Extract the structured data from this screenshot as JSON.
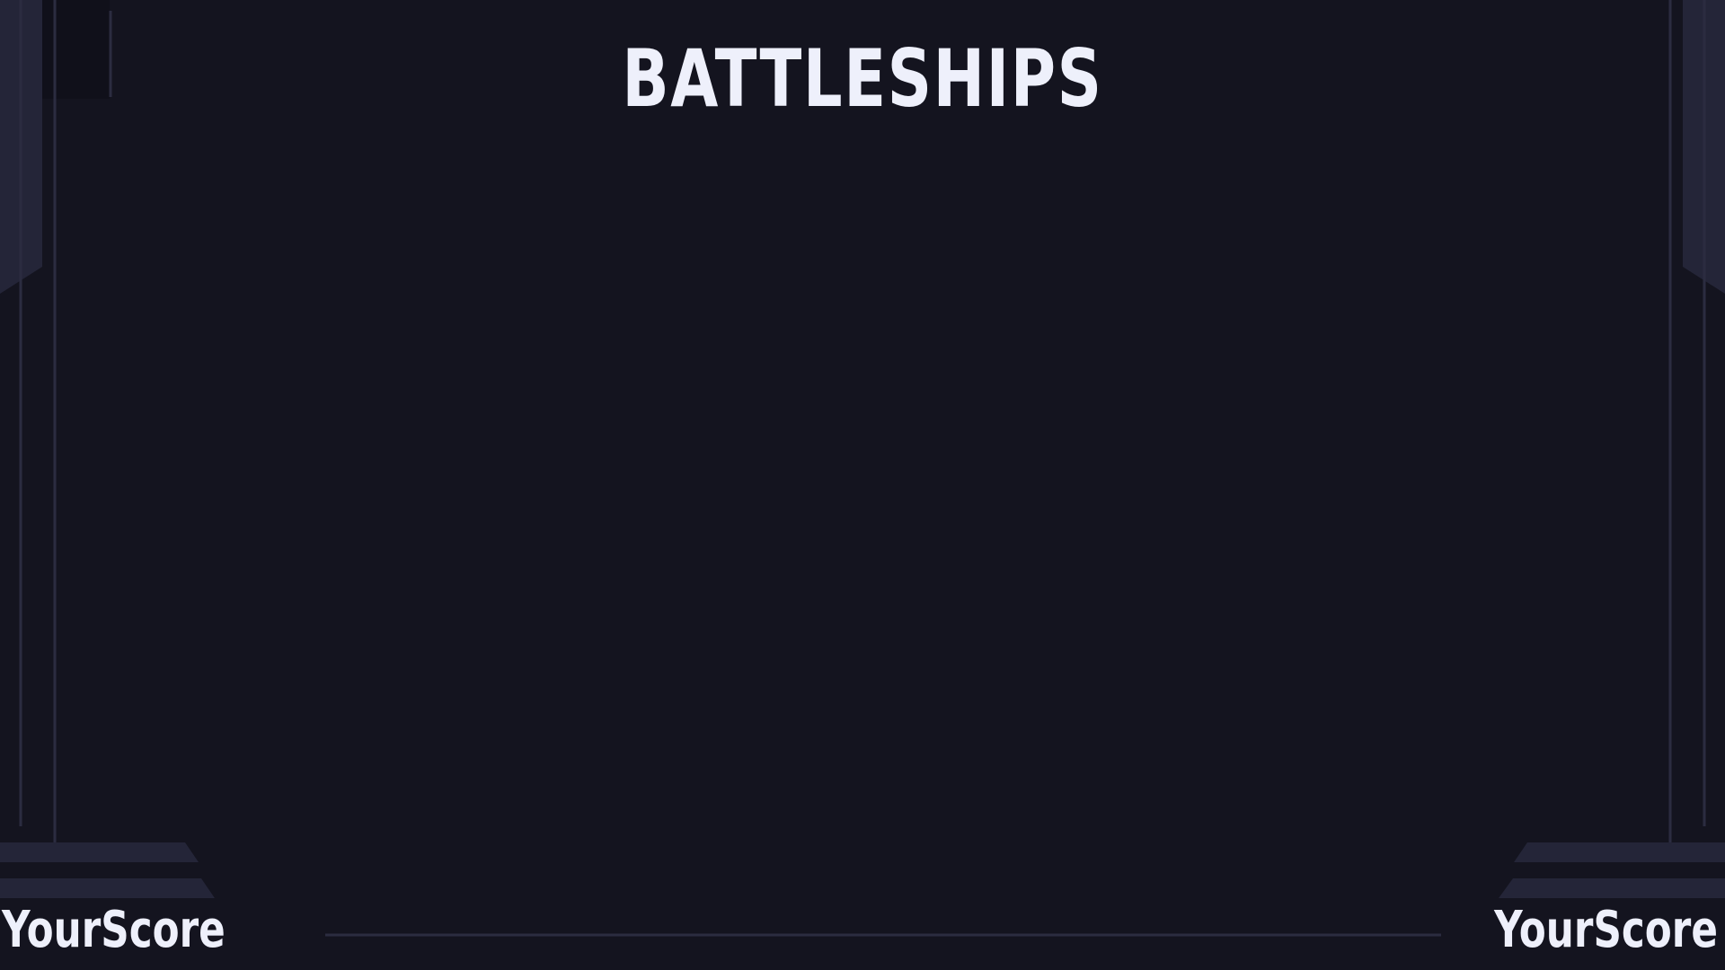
{
  "game": {
    "title": "BATTLESHIPS"
  },
  "scores": {
    "left_label": "YourScore",
    "right_label": "YourScore"
  },
  "colors": {
    "background": "#14141f",
    "panel": "#242538",
    "line": "#2b2c40",
    "text": "#eef0fb"
  }
}
